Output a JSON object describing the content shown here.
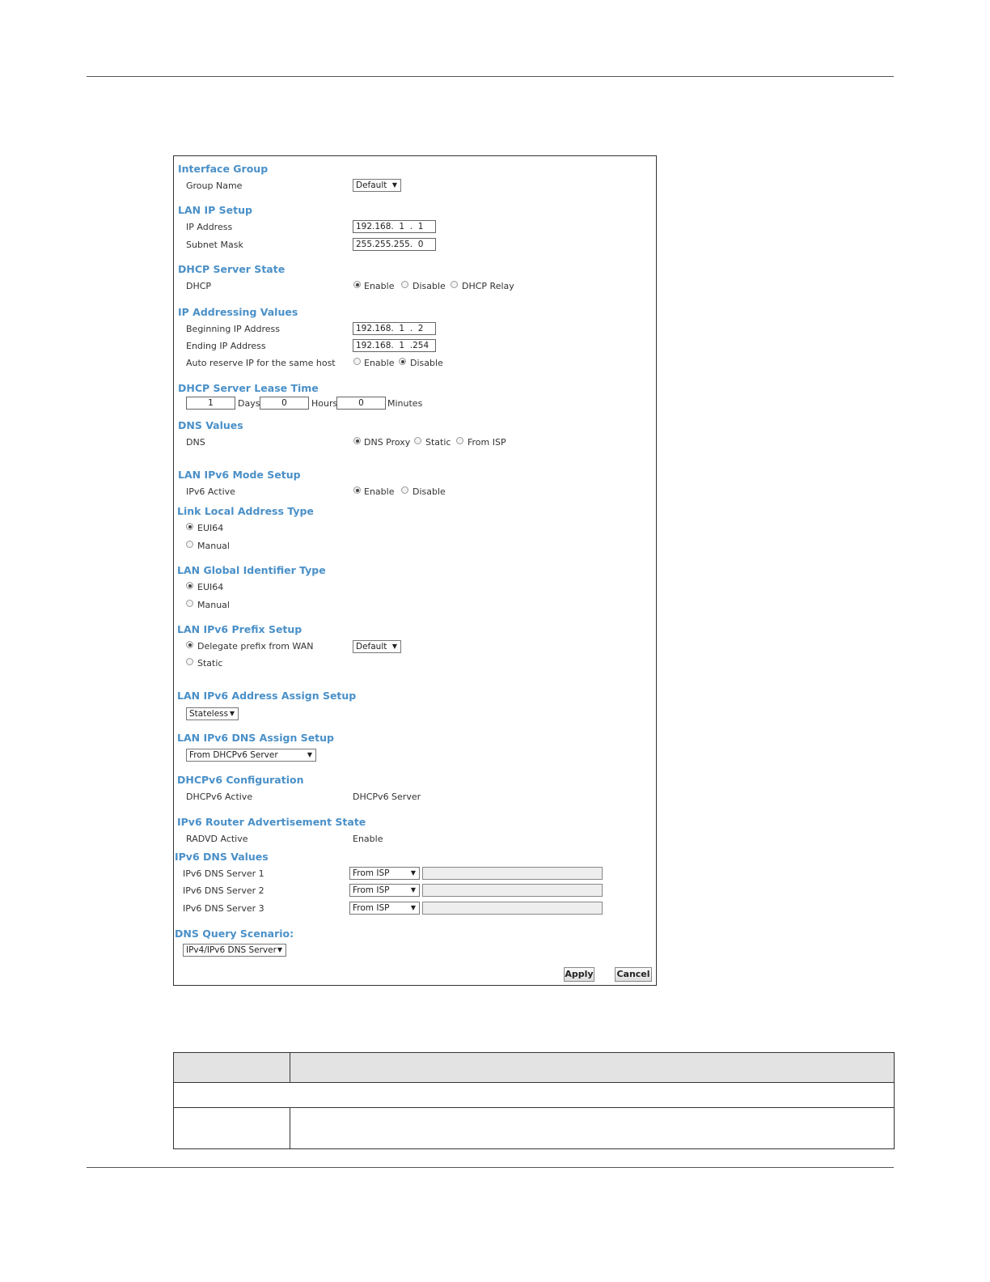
{
  "interface_group": {
    "title": "Interface Group",
    "group_name_label": "Group Name",
    "group_name_value": "Default"
  },
  "lan_ip_setup": {
    "title": "LAN IP Setup",
    "ip_label": "IP Address",
    "ip_value": "192.168.  1  .  1",
    "mask_label": "Subnet Mask",
    "mask_value": "255.255.255.  0"
  },
  "dhcp_server_state": {
    "title": "DHCP Server State",
    "label": "DHCP",
    "options": [
      "Enable",
      "Disable",
      "DHCP Relay"
    ],
    "selected": "Enable"
  },
  "ip_addressing": {
    "title": "IP Addressing Values",
    "begin_label": "Beginning IP Address",
    "begin_value": "192.168.  1  .  2",
    "end_label": "Ending IP Address",
    "end_value": "192.168.  1  .254",
    "auto_label": "Auto reserve IP for the same host",
    "auto_options": [
      "Enable",
      "Disable"
    ],
    "auto_selected": "Disable"
  },
  "lease_time": {
    "title": "DHCP Server Lease Time",
    "days_value": "1",
    "days_label": "Days",
    "hours_value": "0",
    "hours_label": "Hours",
    "minutes_value": "0",
    "minutes_label": "Minutes"
  },
  "dns_values": {
    "title": "DNS Values",
    "label": "DNS",
    "options": [
      "DNS Proxy",
      "Static",
      "From ISP"
    ],
    "selected": "DNS Proxy"
  },
  "ipv6_mode": {
    "title": "LAN IPv6 Mode Setup",
    "label": "IPv6 Active",
    "options": [
      "Enable",
      "Disable"
    ],
    "selected": "Enable"
  },
  "link_local": {
    "title": "Link Local Address Type",
    "options": [
      "EUI64",
      "Manual"
    ],
    "selected": "EUI64"
  },
  "global_id": {
    "title": "LAN Global Identifier Type",
    "options": [
      "EUI64",
      "Manual"
    ],
    "selected": "EUI64"
  },
  "prefix_setup": {
    "title": "LAN IPv6 Prefix Setup",
    "options": [
      "Delegate prefix from WAN",
      "Static"
    ],
    "selected": "Delegate prefix from WAN",
    "wan_select": "Default"
  },
  "address_assign": {
    "title": "LAN IPv6 Address Assign Setup",
    "value": "Stateless"
  },
  "dns_assign": {
    "title": "LAN IPv6 DNS Assign Setup",
    "value": "From DHCPv6 Server"
  },
  "dhcpv6": {
    "title": "DHCPv6 Configuration",
    "label": "DHCPv6 Active",
    "value": "DHCPv6 Server"
  },
  "router_adv": {
    "title": "IPv6 Router Advertisement State",
    "label": "RADVD Active",
    "value": "Enable"
  },
  "ipv6_dns": {
    "title": "IPv6 DNS Values",
    "servers": [
      {
        "label": "IPv6 DNS Server 1",
        "value": "From ISP"
      },
      {
        "label": "IPv6 DNS Server 2",
        "value": "From ISP"
      },
      {
        "label": "IPv6 DNS Server 3",
        "value": "From ISP"
      }
    ]
  },
  "dns_query": {
    "title": "DNS Query Scenario:",
    "value": "IPv4/IPv6 DNS Server"
  },
  "buttons": {
    "apply": "Apply",
    "cancel": "Cancel"
  }
}
